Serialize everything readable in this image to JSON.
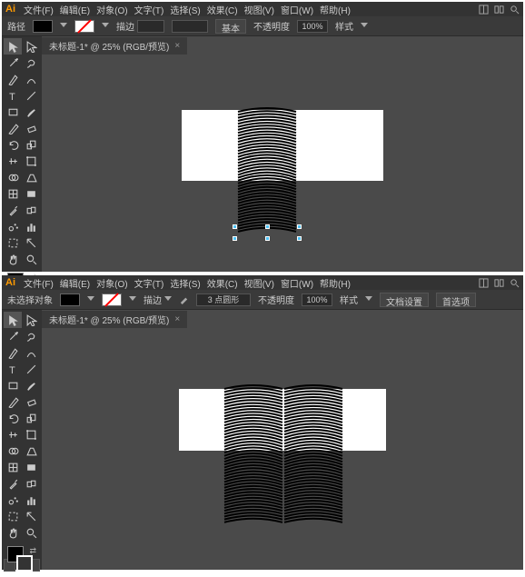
{
  "menus": [
    "文件(F)",
    "编辑(E)",
    "对象(O)",
    "文字(T)",
    "选择(S)",
    "效果(C)",
    "视图(V)",
    "窗口(W)",
    "帮助(H)"
  ],
  "controlbar1": {
    "left_label": "路径",
    "stroke_label": "描边",
    "stroke_val": "",
    "basic": "基本",
    "opacity_label": "不透明度",
    "opacity_val": "100%",
    "style": "样式"
  },
  "controlbar2": {
    "left_label": "未选择对象",
    "stroke_label": "描边",
    "stroke_val": "3 点圆形",
    "opacity_label": "不透明度",
    "opacity_val": "100%",
    "style": "样式",
    "docset": "文档设置",
    "prefs": "首选项"
  },
  "doctab": {
    "name": "未标题-1* @ 25% (RGB/预览)",
    "close": "×"
  },
  "tools": [
    "selection",
    "direct-sel",
    "magic-wand",
    "lasso",
    "pen",
    "curvature",
    "type",
    "line",
    "rectangle",
    "paintbrush",
    "pencil",
    "eraser",
    "rotate",
    "scale",
    "width",
    "free-transform",
    "shape-builder",
    "perspective",
    "mesh",
    "gradient",
    "eyedropper",
    "blend",
    "symbol-spray",
    "column-graph",
    "artboard",
    "slice",
    "hand",
    "zoom"
  ]
}
